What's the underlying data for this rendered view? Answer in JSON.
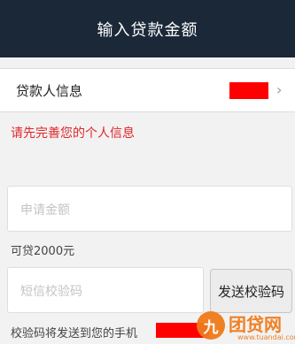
{
  "header": {
    "title": "输入贷款金额"
  },
  "borrower_row": {
    "label": "贷款人信息",
    "chevron": "›"
  },
  "warning": "请先完善您的个人信息",
  "amount_field": {
    "placeholder": "申请金额"
  },
  "available_text": "可贷2000元",
  "verify_field": {
    "placeholder": "短信校验码"
  },
  "send_button": {
    "label": "发送校验码"
  },
  "sent_note": "校验码将发送到您的手机",
  "watermark": {
    "mark": "九",
    "brand": "团贷网",
    "site": "www.tuandai.com"
  },
  "colors": {
    "header_bg": "#1b2838",
    "warning": "#e0262a",
    "redaction": "#ff0000",
    "watermark": "#f07a1a"
  }
}
